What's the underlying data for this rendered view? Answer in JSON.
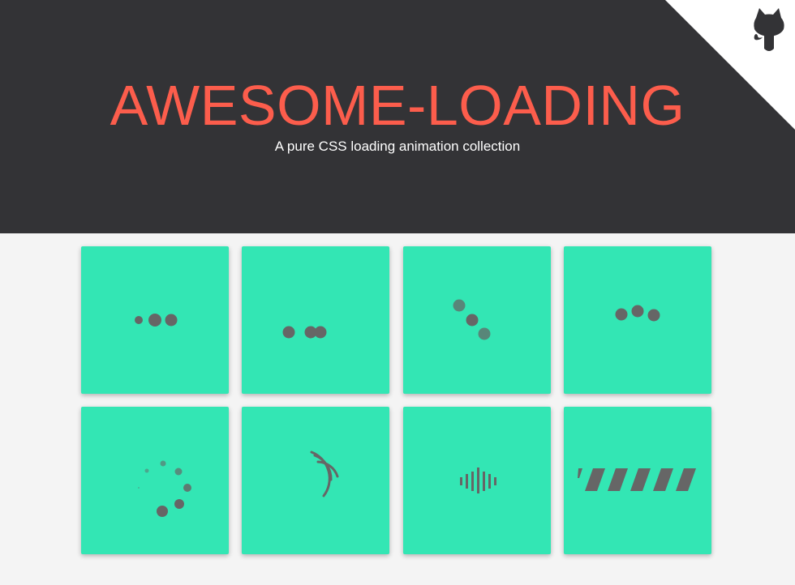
{
  "header": {
    "title": "AWESOME-LOADING",
    "subtitle": "A pure CSS loading animation collection",
    "github_link_icon": "github-octocat-icon"
  },
  "colors": {
    "header_bg": "#333336",
    "title": "#fc5d4c",
    "page_bg": "#f4f4f4",
    "card_bg": "#33e6b4",
    "loader": "#666666"
  },
  "loaders": [
    {
      "icon": "three-dots-growing-icon"
    },
    {
      "icon": "three-dots-merging-icon"
    },
    {
      "icon": "three-dots-diagonal-icon"
    },
    {
      "icon": "three-dots-bouncing-icon"
    },
    {
      "icon": "dots-spinner-icon"
    },
    {
      "icon": "arc-spinner-icon"
    },
    {
      "icon": "equalizer-bars-icon"
    },
    {
      "icon": "striped-progress-bar-icon"
    }
  ]
}
